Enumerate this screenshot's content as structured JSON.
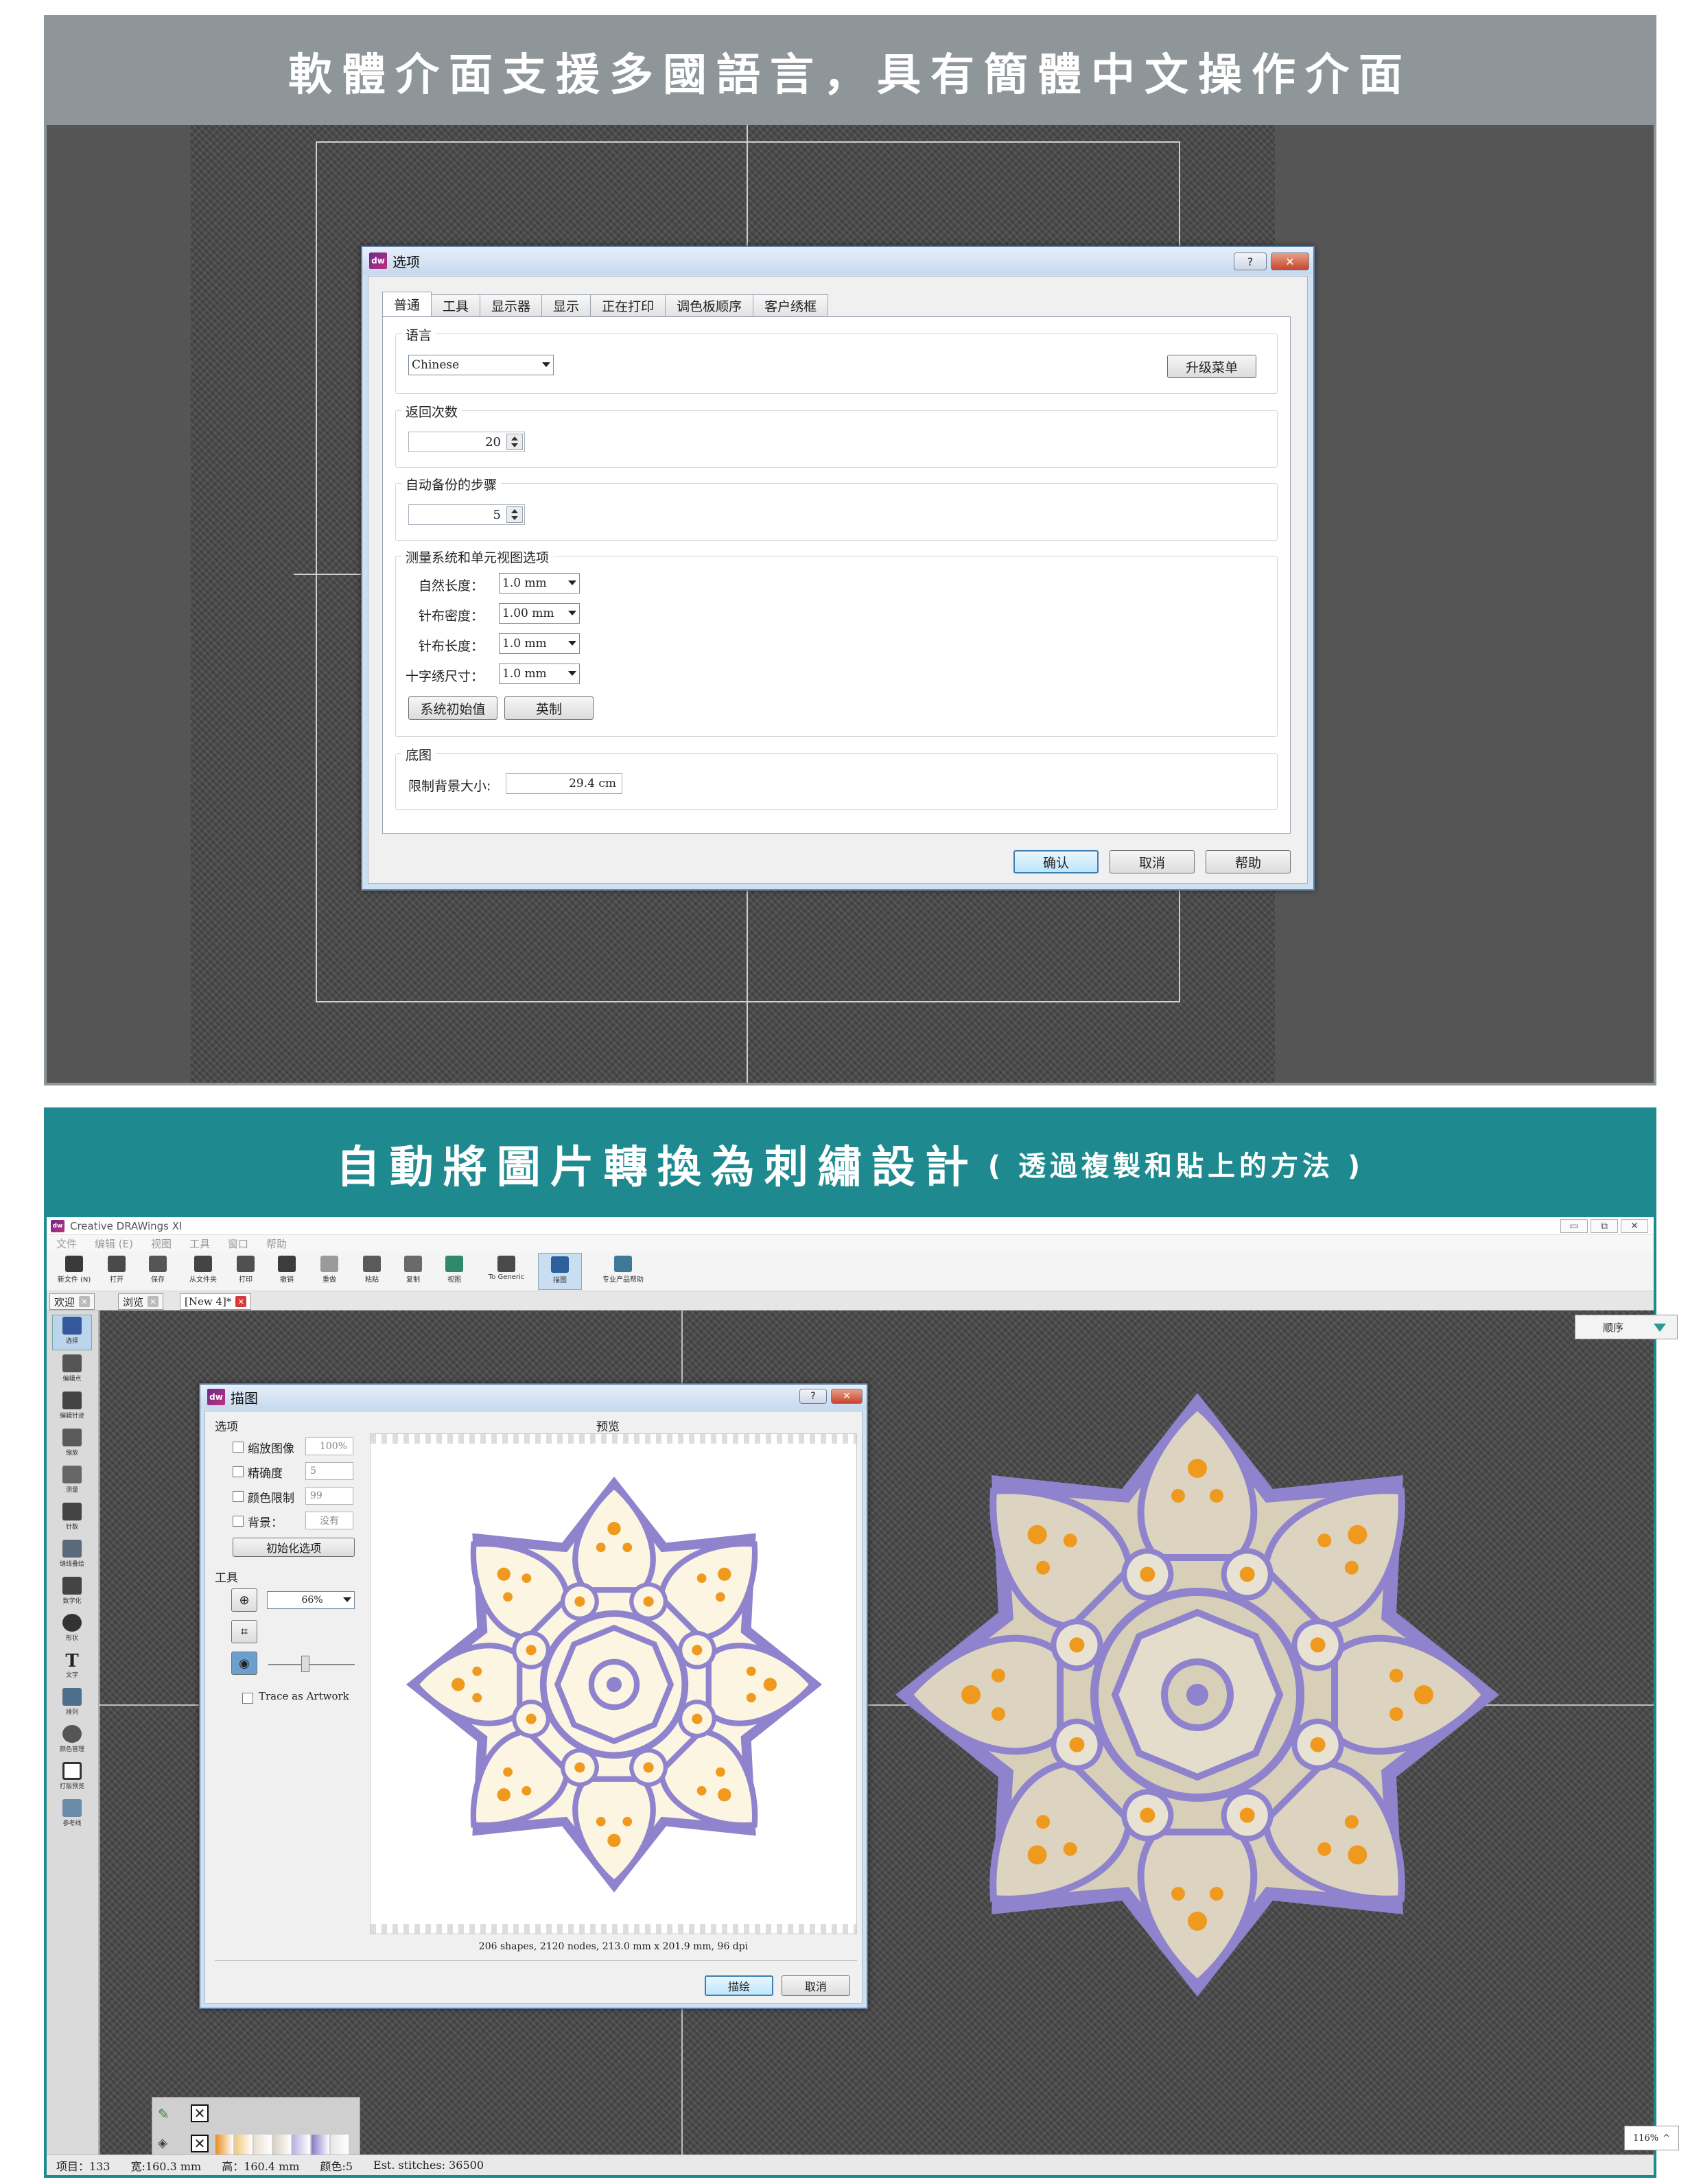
{
  "panel1": {
    "banner": "軟體介面支援多國語言，具有簡體中文操作介面",
    "dialog": {
      "title": "选项",
      "help_btn": "?",
      "tabs": [
        "普通",
        "工具",
        "显示器",
        "显示",
        "正在打印",
        "调色板顺序",
        "客户绣框"
      ],
      "language": {
        "label": "语言",
        "value": "Chinese",
        "upgrade_btn": "升级菜单"
      },
      "undo": {
        "label": "返回次数",
        "value": "20"
      },
      "autosave": {
        "label": "自动备份的步骤",
        "value": "5"
      },
      "measure": {
        "label": "测量系统和单元视图选项",
        "rows": [
          {
            "label": "自然长度：",
            "value": "1.0 mm"
          },
          {
            "label": "针布密度：",
            "value": "1.00 mm"
          },
          {
            "label": "针布长度：",
            "value": "1.0 mm"
          },
          {
            "label": "十字绣尺寸：",
            "value": "1.0 mm"
          }
        ],
        "reset_btn": "系统初始值",
        "imperial_btn": "英制"
      },
      "background": {
        "label": "底图",
        "limit_label": "限制背景大小:",
        "value": "29.4 cm"
      },
      "ok_btn": "确认",
      "cancel_btn": "取消",
      "helpbtn": "帮助"
    }
  },
  "panel2": {
    "banner_main": "自動將圖片轉換為刺繡設計",
    "banner_sub": "( 透過複製和貼上的方法 )",
    "app": {
      "title": "Creative DRAWings XI",
      "menu": [
        "文件",
        "编辑 (E)",
        "视图",
        "工具",
        "窗口",
        "帮助"
      ],
      "toolbar": [
        "新文件 (N)",
        "打开",
        "保存",
        "从文件夹",
        "打印",
        "撤销",
        "重做",
        "粘贴",
        "复制",
        "视图",
        "To Generic",
        "描图",
        "专业产品帮助"
      ],
      "doc_tabs": [
        "欢迎",
        "浏览",
        "[New 4]*"
      ],
      "left_tools": [
        "选择",
        "编辑点",
        "编辑针迹",
        "缩放",
        "测量",
        "针数",
        "缝线叠绘",
        "数字化",
        "形状",
        "文字",
        "排列",
        "颜色管理",
        "打版预览",
        "参考线"
      ],
      "order_btn": "顺序",
      "zoom": "116%",
      "status": [
        "项目：133",
        "宽:160.3 mm",
        "高：160.4 mm",
        "颜色:5",
        "Est. stitches: 36500"
      ]
    },
    "trace_dialog": {
      "title": "描图",
      "options_label": "选项",
      "preview_label": "预览",
      "opt_rows": [
        {
          "label": "缩放图像",
          "value": "100%"
        },
        {
          "label": "精确度",
          "value": "5"
        },
        {
          "label": "颜色限制",
          "value": "99"
        },
        {
          "label": "背景：",
          "value": "没有"
        }
      ],
      "init_btn": "初始化选项",
      "tools_label": "工具",
      "zoom_value": "66%",
      "trace_artwork": "Trace as Artwork",
      "info": "206 shapes, 2120 nodes, 213.0 mm x 201.9 mm, 96 dpi",
      "trace_btn": "描绘",
      "cancel_btn": "取消"
    },
    "palette_colors": [
      "#e88d1a",
      "#f0c878",
      "#e8e0d0",
      "#d8d0c0",
      "#b8b0e0",
      "#8878c8",
      "#e8e8e8"
    ]
  },
  "colors": {
    "gray_banner": "#8f969a",
    "teal_banner": "#1e8a8f",
    "lavender": "#8e83cc",
    "cream": "#fbf5e2",
    "orange": "#ef9a1f"
  }
}
